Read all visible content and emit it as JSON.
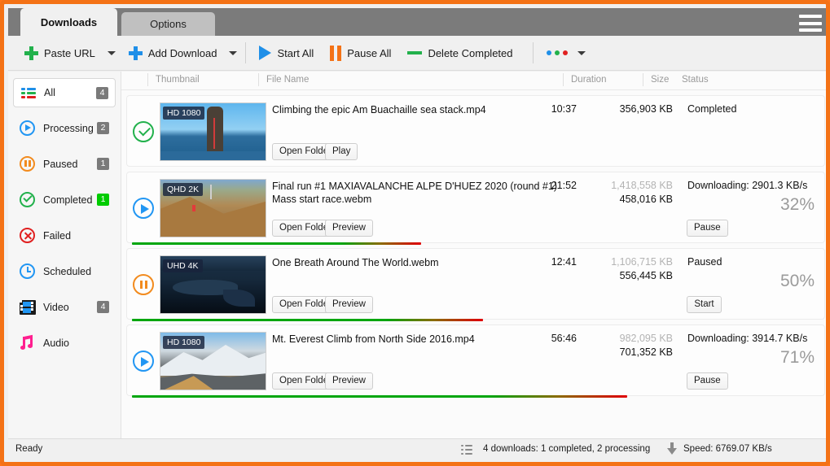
{
  "tabs": [
    {
      "label": "Downloads",
      "active": true
    },
    {
      "label": "Options",
      "active": false
    }
  ],
  "toolbar": {
    "paste_url": "Paste URL",
    "add_download": "Add Download",
    "start_all": "Start All",
    "pause_all": "Pause All",
    "delete_completed": "Delete Completed",
    "more_dot_colors": [
      "#1f8fe8",
      "#22b14c",
      "#e02020"
    ]
  },
  "menu_icon": "hamburger-menu-icon",
  "sidebar": {
    "items": [
      {
        "label": "All",
        "badge": "4",
        "badge_color": "#7a7a7a",
        "icon": "list-icon",
        "selected": true
      },
      {
        "label": "Processing",
        "badge": "2",
        "badge_color": "#7a7a7a",
        "icon": "play-circle-icon",
        "selected": false
      },
      {
        "label": "Paused",
        "badge": "1",
        "badge_color": "#7a7a7a",
        "icon": "pause-circle-icon",
        "selected": false
      },
      {
        "label": "Completed",
        "badge": "1",
        "badge_color": "#00cc00",
        "icon": "check-circle-icon",
        "selected": false
      },
      {
        "label": "Failed",
        "badge": "",
        "badge_color": "",
        "icon": "error-circle-icon",
        "selected": false
      },
      {
        "label": "Scheduled",
        "badge": "",
        "badge_color": "",
        "icon": "clock-icon",
        "selected": false
      },
      {
        "label": "Video",
        "badge": "4",
        "badge_color": "#7a7a7a",
        "icon": "film-icon",
        "selected": false
      },
      {
        "label": "Audio",
        "badge": "",
        "badge_color": "",
        "icon": "music-note-icon",
        "selected": false
      }
    ]
  },
  "table": {
    "headers": {
      "thumbnail": "Thumbnail",
      "file_name": "File Name",
      "duration": "Duration",
      "size": "Size",
      "status": "Status"
    },
    "rows": [
      {
        "state_icon": "check-circle-icon",
        "quality_tag": "HD 1080",
        "file_name": "Climbing the epic Am Buachaille sea stack.mp4",
        "duration": "10:37",
        "size_total": "",
        "size_done": "356,903 KB",
        "status": "Completed",
        "percent": "",
        "progress_value": 100,
        "buttons": [
          "Open Folder",
          "Play"
        ],
        "action_button": "",
        "show_progressbar": false
      },
      {
        "state_icon": "play-circle-icon",
        "quality_tag": "QHD 2K",
        "file_name": "Final run #1  MAXIAVALANCHE ALPE D'HUEZ 2020 (round #1) Mass start race.webm",
        "duration": "21:52",
        "size_total": "1,418,558 KB",
        "size_done": "458,016 KB",
        "status": "Downloading: 2901.3 KB/s",
        "percent": "32%",
        "progress_value": 42,
        "buttons": [
          "Open Folder",
          "Preview"
        ],
        "action_button": "Pause",
        "show_progressbar": true
      },
      {
        "state_icon": "pause-circle-icon",
        "quality_tag": "UHD 4K",
        "file_name": "One Breath Around The World.webm",
        "duration": "12:41",
        "size_total": "1,106,715 KB",
        "size_done": "556,445 KB",
        "status": "Paused",
        "percent": "50%",
        "progress_value": 51,
        "buttons": [
          "Open Folder",
          "Preview"
        ],
        "action_button": "Start",
        "show_progressbar": true
      },
      {
        "state_icon": "play-circle-icon",
        "quality_tag": "HD 1080",
        "file_name": "Mt. Everest Climb from North Side 2016.mp4",
        "duration": "56:46",
        "size_total": "982,095 KB",
        "size_done": "701,352 KB",
        "status": "Downloading: 3914.7 KB/s",
        "percent": "71%",
        "progress_value": 72,
        "buttons": [
          "Open Folder",
          "Preview"
        ],
        "action_button": "Pause",
        "show_progressbar": true
      }
    ]
  },
  "statusbar": {
    "ready": "Ready",
    "downloads_summary": "4 downloads: 1 completed, 2 processing",
    "speed": "Speed: 6769.07 KB/s"
  },
  "colors": {
    "accent_orange": "#f47216",
    "tab_bar": "#7b7b7b",
    "green": "#22b14c",
    "blue": "#1f8fe8",
    "red": "#e02020"
  }
}
